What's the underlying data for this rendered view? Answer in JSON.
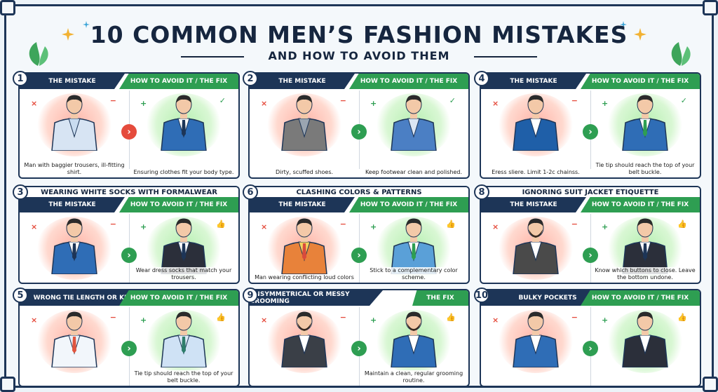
{
  "title": "10 COMMON MEN’S FASHION MISTAKES",
  "subtitle": "AND HOW TO AVOID THEM",
  "colors": {
    "navy": "#1d3557",
    "green": "#2e9e52",
    "red": "#e54b3c"
  },
  "labels": {
    "mistake": "THE MISTAKE",
    "fix": "HOW TO AVOID IT / THE FIX",
    "fix_short": "THE FIX"
  },
  "arrow_glyph": "›",
  "marks": {
    "x": "×",
    "minus": "−",
    "plus": "+",
    "check": "✓",
    "thumb": "👍"
  },
  "panels": [
    {
      "num": "1",
      "topic": "",
      "mistake_caption": "Man with baggier trousers, ill-fitting shirt.",
      "fix_caption": "Ensuring clothes fit your body type."
    },
    {
      "num": "2",
      "topic": "",
      "mistake_caption": "Dirty, scuffed shoes.",
      "fix_caption": "Keep footwear clean and polished."
    },
    {
      "num": "4",
      "topic": "",
      "mistake_caption": "Eress sliere. Limit 1-2c chainss.",
      "fix_caption": "Tie tip should reach the top of your belt buckle."
    },
    {
      "num": "3",
      "topic": "WEARING WHITE SOCKS WITH FORMALWEAR",
      "mistake_caption": "",
      "fix_caption": "Wear dress socks that match your trousers."
    },
    {
      "num": "6",
      "topic": "CLASHING COLORS & PATTERNS",
      "mistake_caption": "Man wearing conflicting loud colors",
      "fix_caption": "Stick to a complementary color scheme."
    },
    {
      "num": "8",
      "topic": "IGNORING SUIT JACKET ETIQUETTE",
      "mistake_caption": "",
      "fix_caption": "Know which buttons to close. Leave the bottom undone."
    },
    {
      "num": "5",
      "topic": "",
      "mistake_label": "WRONG TIE LENGTH OR KNOT",
      "mistake_caption": "",
      "fix_caption": "Tie tip should reach the top of your belt buckle."
    },
    {
      "num": "9",
      "topic": "",
      "mistake_label": "UNSYMMETRICAL OR MESSY GROOMING",
      "mistake_caption": "",
      "fix_caption": "Maintain a clean, regular grooming routine."
    },
    {
      "num": "10",
      "topic": "",
      "mistake_label": "BULKY POCKETS",
      "mistake_caption": "",
      "fix_caption": ""
    }
  ]
}
